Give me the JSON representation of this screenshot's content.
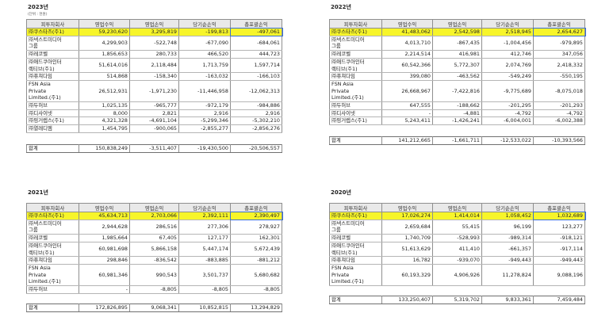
{
  "unit_note": "(단위 : 천원)",
  "headers": [
    "피투자회사",
    "영업수익",
    "영업손익",
    "당기순손익",
    "총포괄손익"
  ],
  "total_label": "합계",
  "tables": [
    {
      "year": "2023년",
      "rows": [
        {
          "name": "㈜쿠스타즈(주1)",
          "vals": [
            "59,230,620",
            "3,295,819",
            "-199,813",
            "-497,061"
          ],
          "highlight": true
        },
        {
          "name": "㈜넥스트미디어\n그룹",
          "vals": [
            "4,299,903",
            "-522,748",
            "-677,090",
            "-684,061"
          ]
        },
        {
          "name": "㈜레코벨",
          "vals": [
            "1,856,653",
            "280,733",
            "466,520",
            "444,723"
          ]
        },
        {
          "name": "㈜애드쿠아인터\n렉티브(주1)",
          "vals": [
            "51,614,016",
            "2,118,484",
            "1,713,759",
            "1,597,714"
          ]
        },
        {
          "name": "㈜퓨쳐다임",
          "vals": [
            "514,868",
            "-158,340",
            "-163,032",
            "-166,103"
          ]
        },
        {
          "name": "FSN Asia\nPrivate\nLimited.(주1)",
          "vals": [
            "26,512,931",
            "-1,971,230",
            "-11,446,958",
            "-12,062,313"
          ]
        },
        {
          "name": "㈜두허브",
          "vals": [
            "1,025,135",
            "-965,777",
            "-972,179",
            "-984,886"
          ]
        },
        {
          "name": "㈜디사이넷",
          "vals": [
            "8,000",
            "2,821",
            "2,916",
            "2,916"
          ]
        },
        {
          "name": "㈜핑거렙스(주1)",
          "vals": [
            "4,321,328",
            "-4,691,104",
            "-5,299,346",
            "-5,302,210"
          ]
        },
        {
          "name": "㈜열레디엠",
          "vals": [
            "1,454,795",
            "-900,065",
            "-2,855,277",
            "-2,856,276"
          ]
        }
      ],
      "total": [
        "150,838,249",
        "-3,511,407",
        "-19,430,500",
        "-20,506,557"
      ]
    },
    {
      "year": "2022년",
      "rows": [
        {
          "name": "㈜쿠스타즈(주1)",
          "vals": [
            "41,483,062",
            "2,542,598",
            "2,518,945",
            "2,654,627"
          ],
          "highlight": true
        },
        {
          "name": "㈜넥스트미디어\n그룹",
          "vals": [
            "4,013,710",
            "-867,435",
            "-1,004,456",
            "-979,895"
          ]
        },
        {
          "name": "㈜레코벨",
          "vals": [
            "2,214,514",
            "416,981",
            "412,746",
            "347,056"
          ]
        },
        {
          "name": "㈜애드쿠아인터\n렉티브(주1)",
          "vals": [
            "60,542,366",
            "5,772,307",
            "2,074,769",
            "2,418,332"
          ]
        },
        {
          "name": "㈜퓨쳐다임",
          "vals": [
            "399,080",
            "-463,562",
            "-549,249",
            "-550,195"
          ]
        },
        {
          "name": "FSN Asia\nPrivate\nLimited.(주1)",
          "vals": [
            "26,668,967",
            "-7,422,816",
            "-9,775,689",
            "-8,075,018"
          ]
        },
        {
          "name": "㈜두허브",
          "vals": [
            "647,555",
            "-188,662",
            "-201,295",
            "-201,293"
          ]
        },
        {
          "name": "㈜디사이넷",
          "vals": [
            "-",
            "-4,881",
            "-4,792",
            "-4,792"
          ]
        },
        {
          "name": "㈜핑거렙스(주1)",
          "vals": [
            "5,243,411",
            "-1,426,241",
            "-6,004,001",
            "-6,002,388"
          ]
        }
      ],
      "total": [
        "141,212,665",
        "-1,661,711",
        "-12,533,022",
        "-10,393,566"
      ]
    },
    {
      "year": "2021년",
      "rows": [
        {
          "name": "㈜쿠스타즈(주1)",
          "vals": [
            "45,634,713",
            "2,703,066",
            "2,392,111",
            "2,390,497"
          ],
          "highlight": true
        },
        {
          "name": "㈜넥스트미디어\n그룹",
          "vals": [
            "2,944,628",
            "286,516",
            "277,306",
            "278,927"
          ]
        },
        {
          "name": "㈜레코벨",
          "vals": [
            "1,985,664",
            "67,405",
            "127,177",
            "162,301"
          ]
        },
        {
          "name": "㈜애드쿠아인터\n렉티브(주1)",
          "vals": [
            "60,981,698",
            "5,866,158",
            "5,447,174",
            "5,672,439"
          ]
        },
        {
          "name": "㈜퓨쳐다임",
          "vals": [
            "298,846",
            "-836,542",
            "-883,885",
            "-881,212"
          ]
        },
        {
          "name": "FSN Asia\nPrivate\nLimited.(주1)",
          "vals": [
            "60,981,346",
            "990,543",
            "3,501,737",
            "5,680,682"
          ]
        },
        {
          "name": "㈜두허브",
          "vals": [
            "-",
            "-8,805",
            "-8,805",
            "-8,805"
          ]
        }
      ],
      "total": [
        "172,826,895",
        "9,068,341",
        "10,852,815",
        "13,294,829"
      ]
    },
    {
      "year": "2020년",
      "rows": [
        {
          "name": "㈜쿠스타즈(주1)",
          "vals": [
            "17,026,274",
            "1,414,014",
            "1,058,452",
            "1,032,689"
          ],
          "highlight": true
        },
        {
          "name": "㈜넥스트미디어\n그룹",
          "vals": [
            "2,659,684",
            "55,415",
            "96,199",
            "123,277"
          ]
        },
        {
          "name": "㈜레코벨",
          "vals": [
            "1,740,709",
            "-528,993",
            "-989,314",
            "-918,121"
          ]
        },
        {
          "name": "㈜애드쿠아인터\n렉티브(주1)",
          "vals": [
            "51,613,629",
            "411,410",
            "-661,357",
            "-917,114"
          ]
        },
        {
          "name": "㈜퓨쳐다임",
          "vals": [
            "16,782",
            "-939,070",
            "-949,443",
            "-949,443"
          ]
        },
        {
          "name": "FSN Asia\nPrivate\nLimited.(주1)",
          "vals": [
            "60,193,329",
            "4,906,926",
            "11,278,824",
            "9,088,196"
          ]
        }
      ],
      "total": [
        "133,250,407",
        "5,319,702",
        "9,833,361",
        "7,459,484"
      ]
    }
  ]
}
